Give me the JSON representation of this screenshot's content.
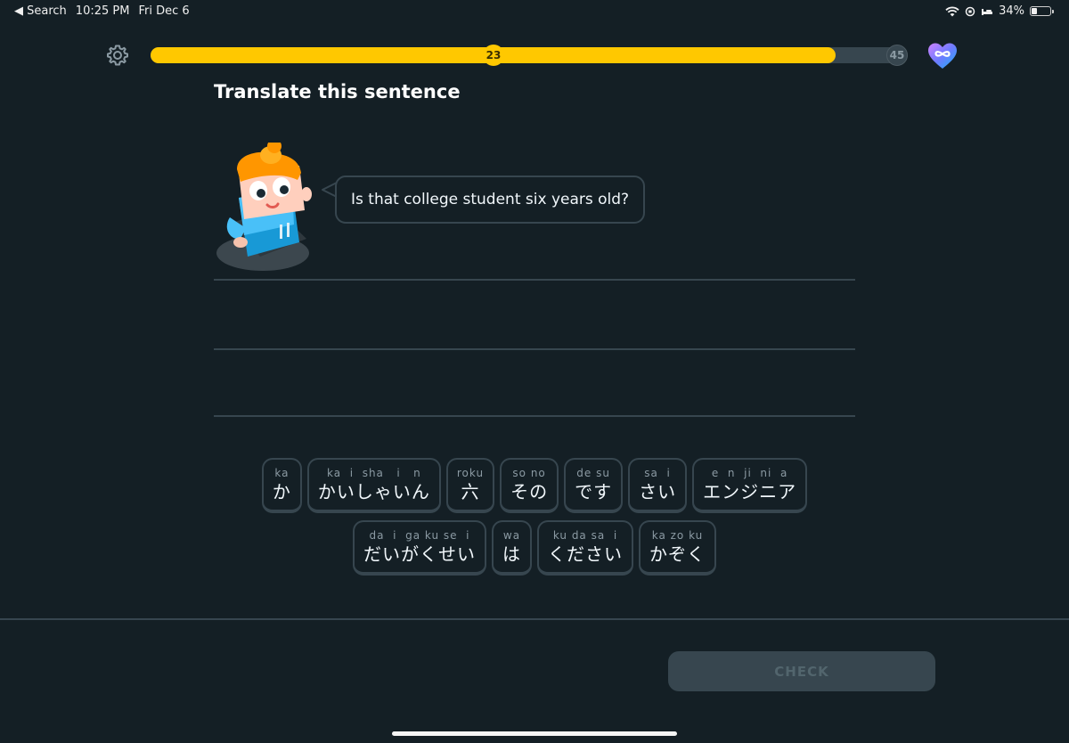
{
  "status_bar": {
    "back_label": "◀ Search",
    "time": "10:25 PM",
    "date": "Fri Dec 6",
    "battery_percent": "34%",
    "battery_level": 0.34
  },
  "progress": {
    "current": "23",
    "total": "45",
    "fraction": 0.905,
    "color": "#ffc800"
  },
  "icons": {
    "settings": "gear-icon",
    "hearts": "infinity-heart-icon"
  },
  "title": "Translate this sentence",
  "prompt": "Is that college student six years old?",
  "word_bank": {
    "rows": [
      [
        {
          "roma": "ka",
          "kana": "か"
        },
        {
          "roma": "ka  i  sha   i   n",
          "kana": "かいしゃいん"
        },
        {
          "roma": "roku",
          "kana": "六"
        },
        {
          "roma": "so no",
          "kana": "その"
        },
        {
          "roma": "de su",
          "kana": "です"
        },
        {
          "roma": "sa  i",
          "kana": "さい"
        },
        {
          "roma": "e  n  ji  ni  a",
          "kana": "エンジニア"
        }
      ],
      [
        {
          "roma": "da  i  ga ku se  i",
          "kana": "だいがくせい"
        },
        {
          "roma": "wa",
          "kana": "は"
        },
        {
          "roma": "ku da sa  i",
          "kana": "ください"
        },
        {
          "roma": "ka zo ku",
          "kana": "かぞく"
        }
      ]
    ]
  },
  "check_label": "CHECK",
  "colors": {
    "background": "#141f25",
    "border": "#37464f",
    "accent": "#ffc800"
  }
}
